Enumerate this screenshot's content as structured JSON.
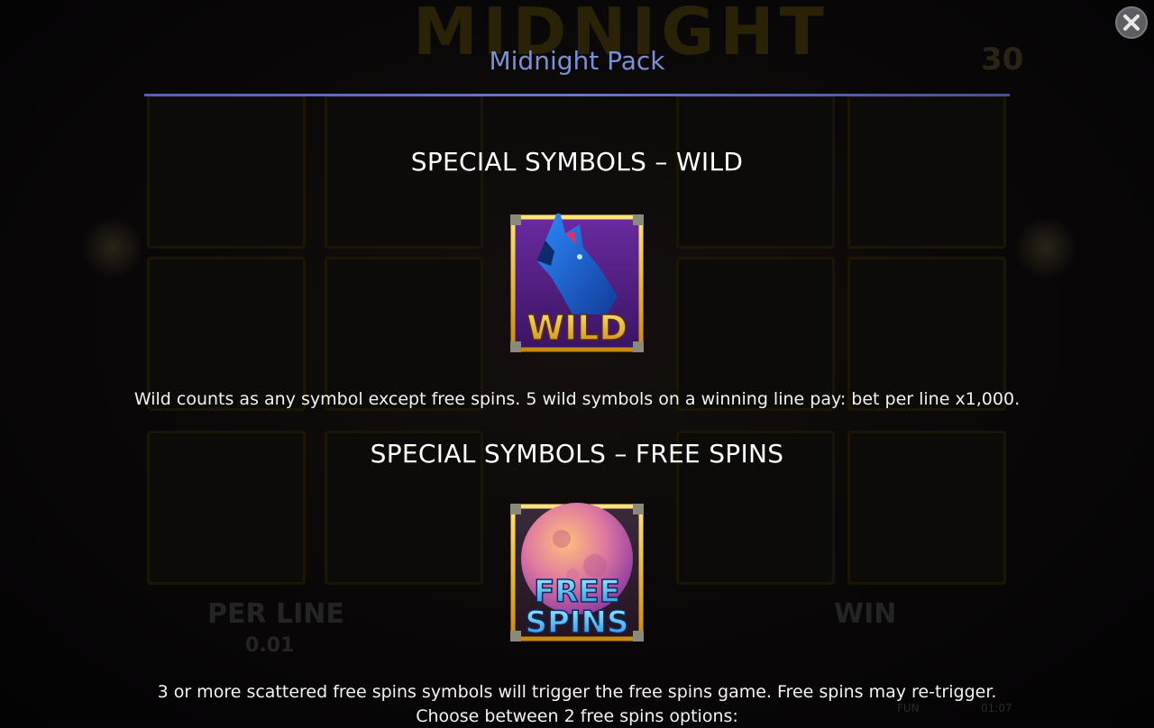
{
  "background": {
    "game_title": "MIDNIGHT",
    "lines_value": "30",
    "per_line_label": "PER LINE",
    "per_line_value": "0.01",
    "win_label": "WIN",
    "mode_label": "FUN",
    "clock": "01:07"
  },
  "header": {
    "title": "Midnight Pack"
  },
  "close_icon": "close-icon",
  "sections": [
    {
      "title": "SPECIAL SYMBOLS – WILD",
      "symbol_text": "WILD",
      "description": "Wild counts as any symbol except free spins. 5 wild symbols on a winning line pay: bet per line x1,000."
    },
    {
      "title": "SPECIAL SYMBOLS – FREE SPINS",
      "symbol_text_line1": "FREE",
      "symbol_text_line2": "SPINS",
      "description": "3 or more scattered free spins symbols will trigger the free spins game. Free spins may re-trigger.",
      "description_line2": "Choose between 2 free spins options:"
    }
  ],
  "colors": {
    "accent": "#7b8fd6",
    "rule": "#6c74c8",
    "frame_gold": "#c9961e",
    "wild_bg": "#4b1f7a",
    "wolf_blue": "#1f6fd6"
  }
}
